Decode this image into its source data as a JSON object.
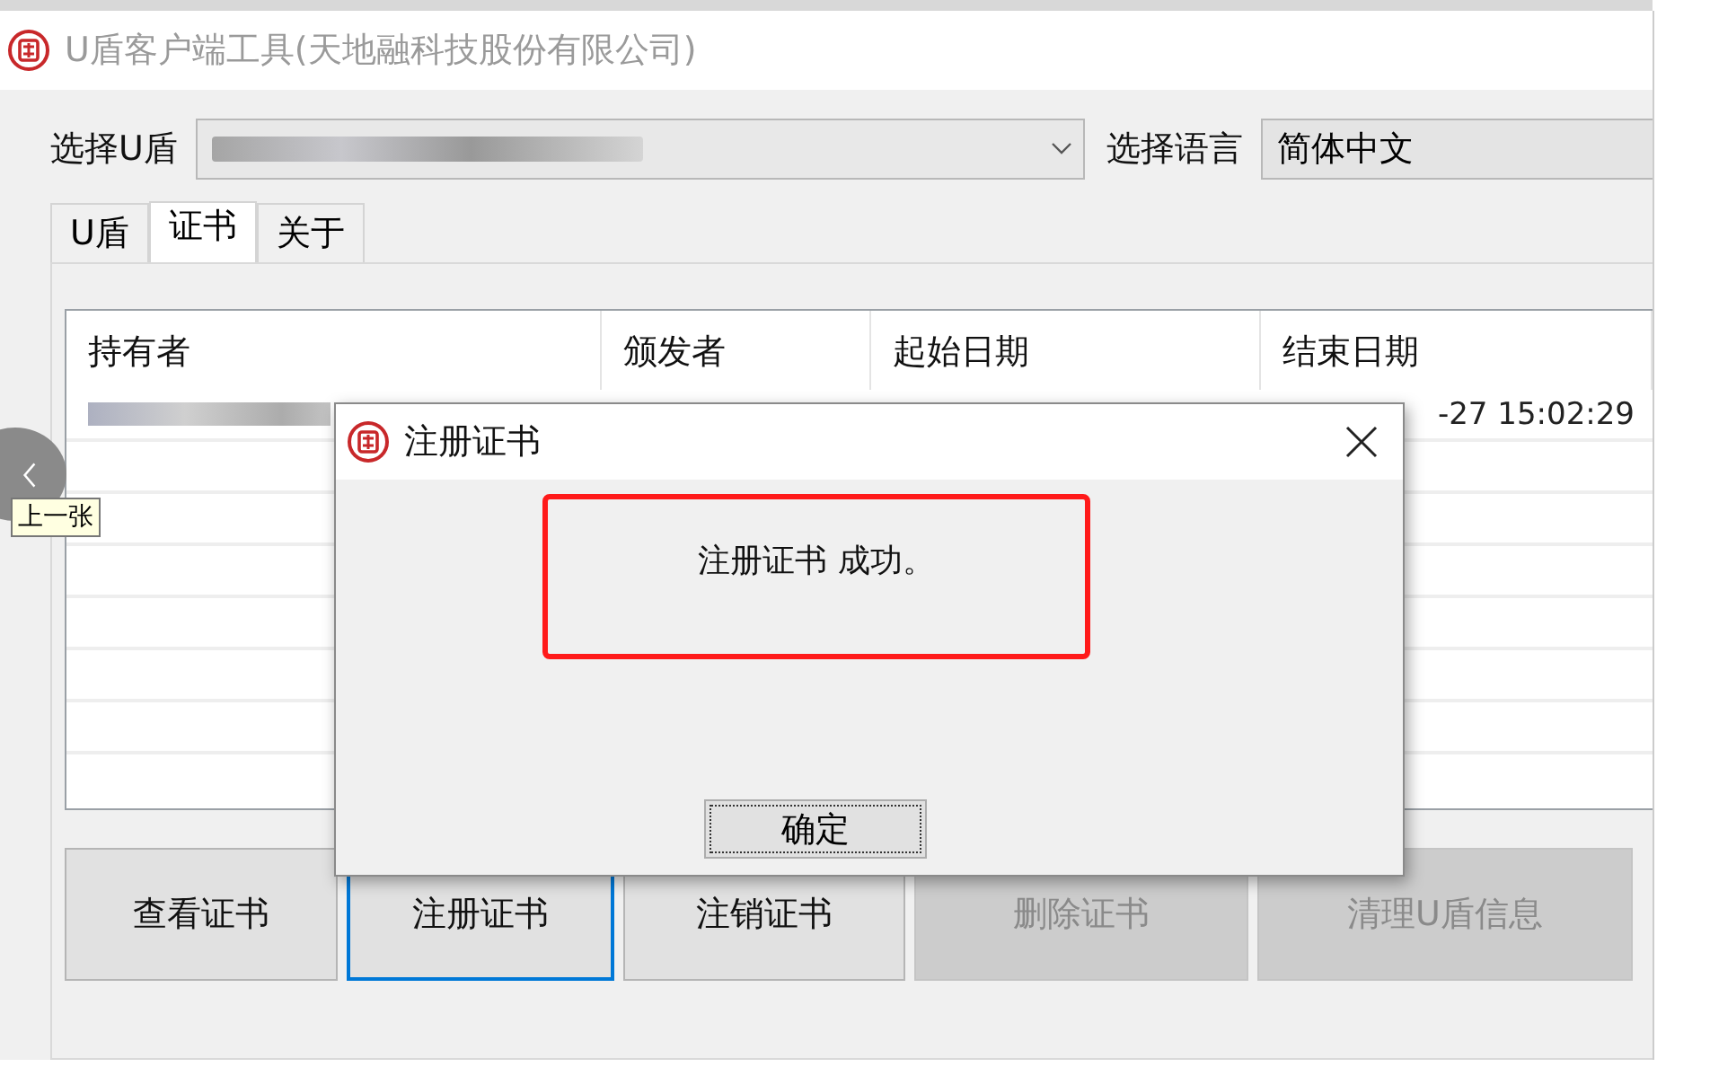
{
  "window": {
    "title": "U盾客户端工具(天地融科技股份有限公司)"
  },
  "ukey_select": {
    "label": "选择U盾"
  },
  "language_select": {
    "label": "选择语言",
    "value": "简体中文"
  },
  "tabs": [
    {
      "label": "U盾",
      "selected": false
    },
    {
      "label": "证书",
      "selected": true
    },
    {
      "label": "关于",
      "selected": false
    }
  ],
  "table": {
    "columns": [
      "持有者",
      "颁发者",
      "起始日期",
      "结束日期"
    ],
    "rows": [
      {
        "end_date": "-27 15:02:29"
      }
    ]
  },
  "buttons": [
    {
      "label": "查看证书",
      "disabled": false,
      "focused": false
    },
    {
      "label": "注册证书",
      "disabled": false,
      "focused": true
    },
    {
      "label": "注销证书",
      "disabled": false,
      "focused": false
    },
    {
      "label": "删除证书",
      "disabled": true,
      "focused": false
    },
    {
      "label": "清理U盾信息",
      "disabled": true,
      "focused": false
    }
  ],
  "dialog": {
    "title": "注册证书",
    "message": "注册证书 成功。",
    "ok_button": "确定"
  },
  "viewer": {
    "prev_tooltip": "上一张"
  }
}
